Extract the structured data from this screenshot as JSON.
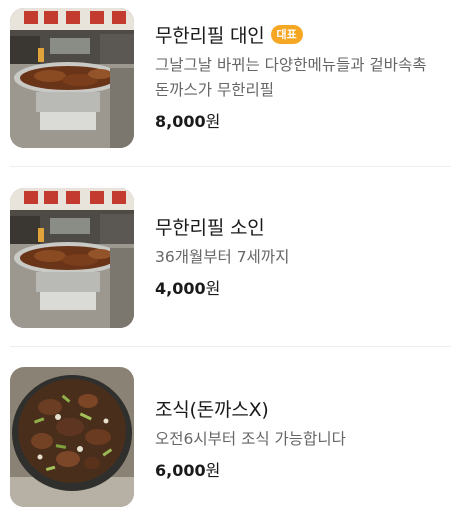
{
  "menu": {
    "items": [
      {
        "title": "무한리필 대인",
        "badge": "대표",
        "description": "그날그날 바뀌는 다양한메뉴들과 겉바속촉 돈까스가 무한리필",
        "price_number": "8,000",
        "price_unit": "원",
        "image": "buffet-tray-photo"
      },
      {
        "title": "무한리필 소인",
        "description": "36개월부터 7세까지",
        "price_number": "4,000",
        "price_unit": "원",
        "image": "buffet-tray-photo"
      },
      {
        "title": "조식(돈까스X)",
        "description": "오전6시부터 조식 가능합니다",
        "price_number": "6,000",
        "price_unit": "원",
        "image": "braised-meat-dish-photo"
      }
    ]
  },
  "colors": {
    "badge": "#f5a623",
    "title": "#1a1a1a",
    "description": "#666666",
    "divider": "#eeeeee"
  }
}
